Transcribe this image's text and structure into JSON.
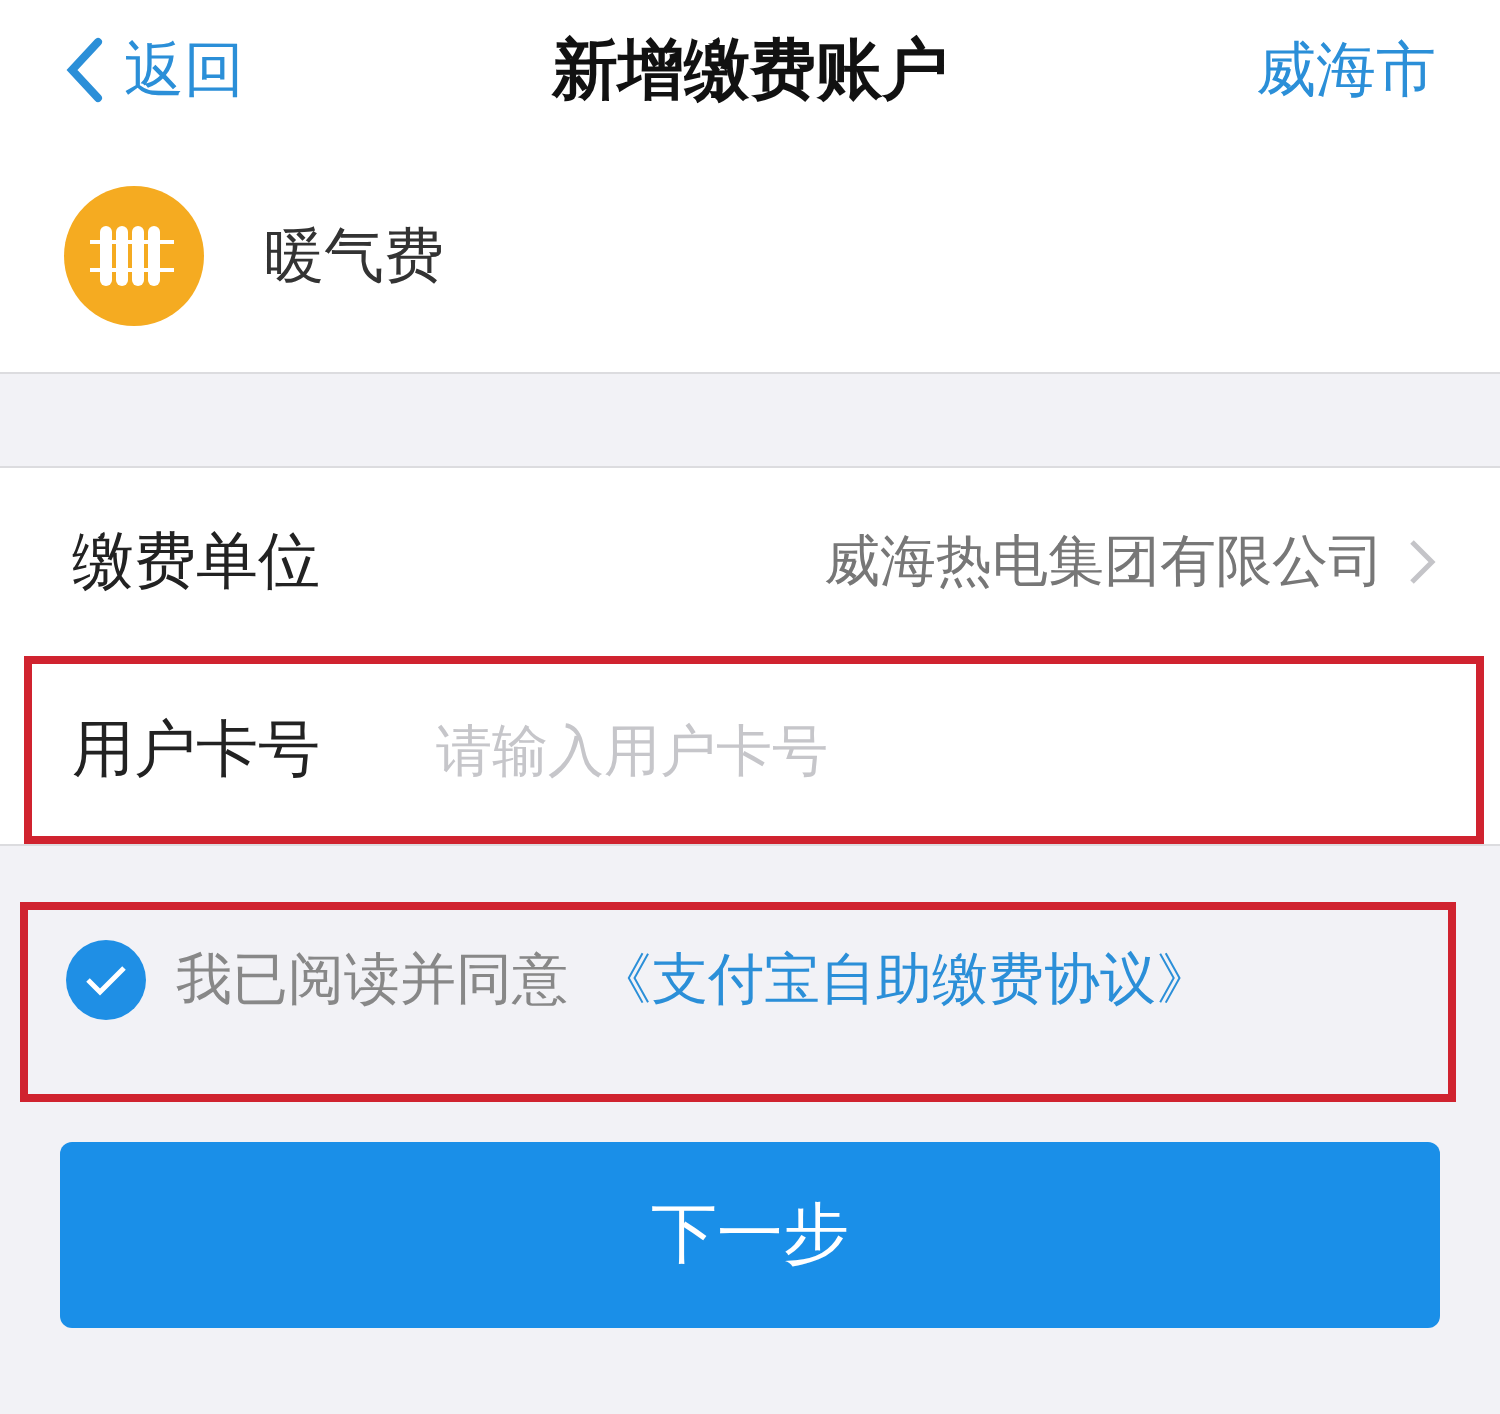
{
  "nav": {
    "back": "返回",
    "title": "新增缴费账户",
    "city": "威海市"
  },
  "category": {
    "name": "暖气费"
  },
  "fields": [
    {
      "kind": "select",
      "label": "缴费单位",
      "value": "威海热电集团有限公司",
      "highlighted": false
    },
    {
      "kind": "input",
      "label": "用户卡号",
      "placeholder": "请输入用户卡号",
      "highlighted": true
    }
  ],
  "agreement": {
    "checked": true,
    "text": "我已阅读并同意",
    "link": "《支付宝自助缴费协议》",
    "highlighted": true
  },
  "next_button": "下一步"
}
